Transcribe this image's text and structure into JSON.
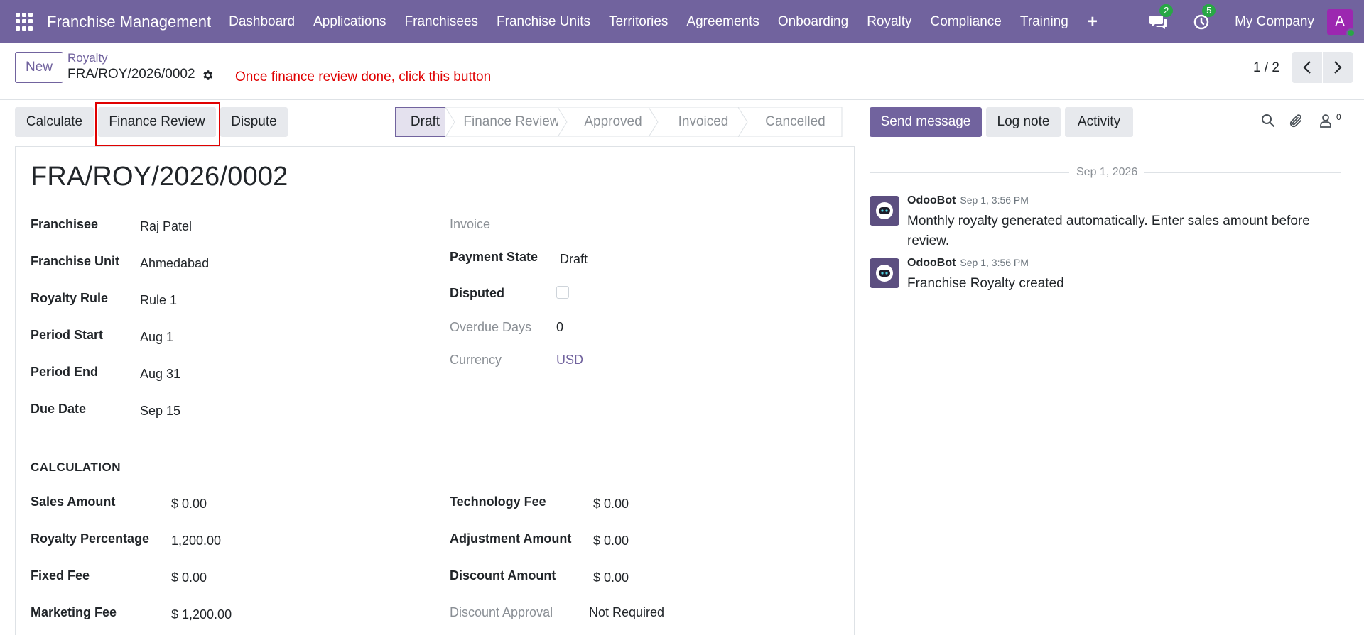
{
  "navbar": {
    "app_title": "Franchise Management",
    "menu": [
      "Dashboard",
      "Applications",
      "Franchisees",
      "Franchise Units",
      "Territories",
      "Agreements",
      "Onboarding",
      "Royalty",
      "Compliance",
      "Training"
    ],
    "messages_count": "2",
    "activities_count": "5",
    "company": "My Company",
    "avatar_letter": "A"
  },
  "control_panel": {
    "new_label": "New",
    "breadcrumb": "Royalty",
    "record_name": "FRA/ROY/2026/0002",
    "annotation": "Once finance review done, click this button",
    "pager": "1 / 2"
  },
  "actions": {
    "calculate": "Calculate",
    "finance_review": "Finance Review",
    "dispute": "Dispute"
  },
  "statusbar": {
    "stages": [
      "Draft",
      "Finance Review",
      "Approved",
      "Invoiced",
      "Cancelled"
    ],
    "active": "Draft"
  },
  "form": {
    "title": "FRA/ROY/2026/0002",
    "left": [
      {
        "label": "Franchisee",
        "value": "Raj Patel"
      },
      {
        "label": "Franchise Unit",
        "value": "Ahmedabad"
      },
      {
        "label": "Royalty Rule",
        "value": "Rule 1"
      },
      {
        "label": "Period Start",
        "value": "Aug 1"
      },
      {
        "label": "Period End",
        "value": "Aug 31"
      },
      {
        "label": "Due Date",
        "value": "Sep 15"
      }
    ],
    "right": {
      "invoice_label": "Invoice",
      "payment_state_label": "Payment State",
      "payment_state_value": "Draft",
      "disputed_label": "Disputed",
      "disputed_checked": false,
      "overdue_label": "Overdue Days",
      "overdue_value": "0",
      "currency_label": "Currency",
      "currency_value": "USD"
    },
    "calculation_title": "CALCULATION",
    "calc_left": [
      {
        "label": "Sales Amount",
        "value": "$ 0.00"
      },
      {
        "label": "Royalty Percentage",
        "value": "1,200.00"
      },
      {
        "label": "Fixed Fee",
        "value": "$ 0.00"
      },
      {
        "label": "Marketing Fee",
        "value": "$ 1,200.00"
      }
    ],
    "calc_right": [
      {
        "label": "Technology Fee",
        "value": "$ 0.00"
      },
      {
        "label": "Adjustment Amount",
        "value": "$ 0.00"
      },
      {
        "label": "Discount Amount",
        "value": "$ 0.00"
      },
      {
        "label": "Discount Approval",
        "value": "Not Required"
      }
    ]
  },
  "chatter": {
    "send_message": "Send message",
    "log_note": "Log note",
    "activity": "Activity",
    "followers_count": "0",
    "date_separator": "Sep 1, 2026",
    "messages": [
      {
        "author": "OdooBot",
        "time": "Sep 1, 3:56 PM",
        "body": "Monthly royalty generated automatically. Enter sales amount before review."
      },
      {
        "author": "OdooBot",
        "time": "Sep 1, 3:56 PM",
        "body": "Franchise Royalty created"
      }
    ]
  },
  "colors": {
    "brand": "#71639e",
    "annotation": "#e00000",
    "badge": "#28a745"
  }
}
